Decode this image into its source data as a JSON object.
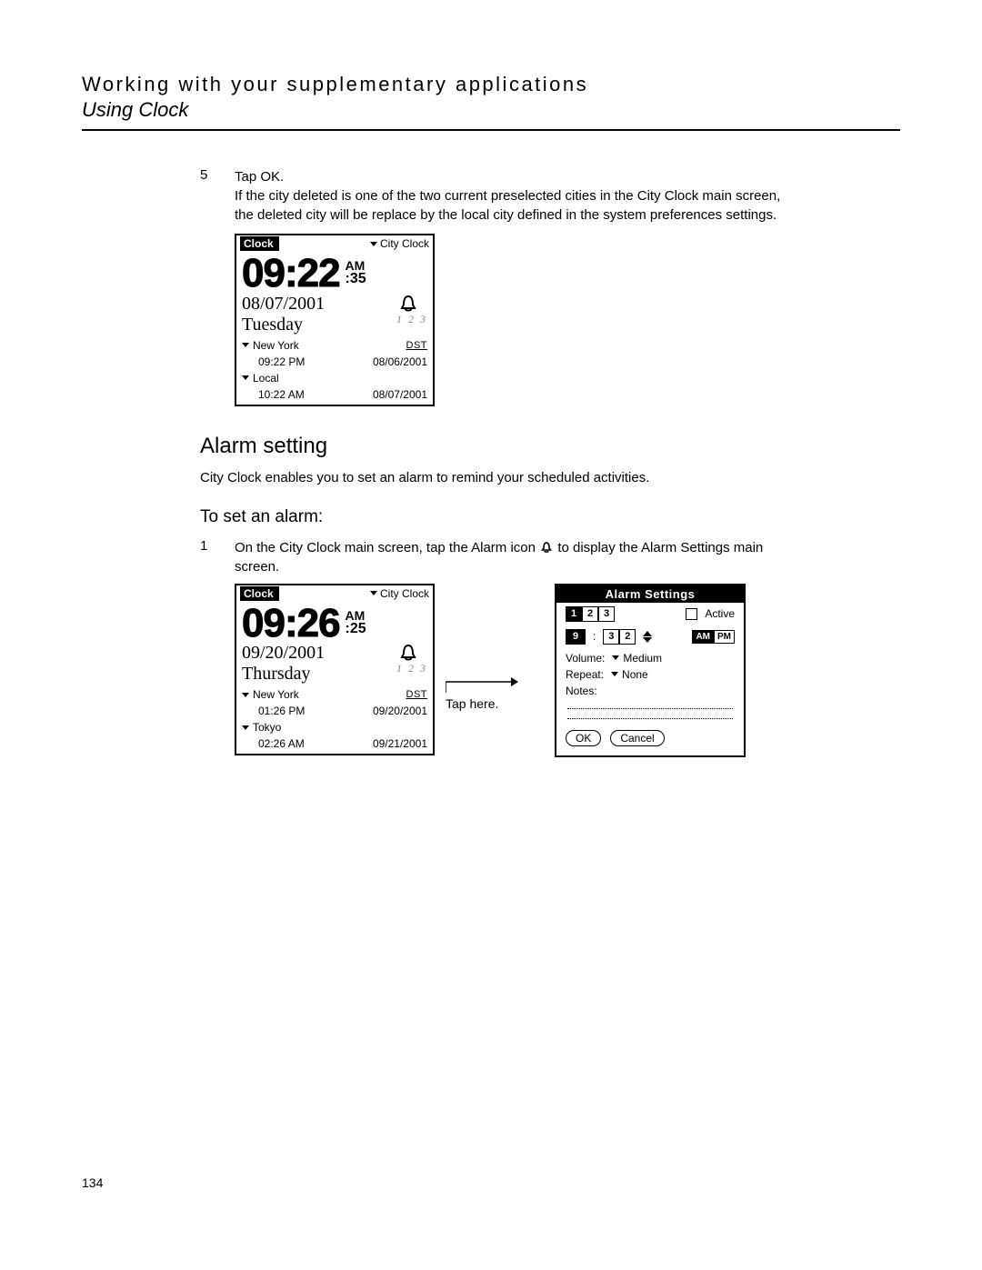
{
  "header": {
    "title": "Working with your supplementary applications",
    "subtitle": "Using Clock"
  },
  "step5": {
    "num": "5",
    "lead": "Tap OK.",
    "body": "If the city deleted is one of the two current preselected cities in the City Clock main screen, the deleted city will be replace by the local city defined in the system preferences settings."
  },
  "screen1": {
    "app_label": "Clock",
    "mode_label": "City Clock",
    "time": "09:22",
    "ampm": "AM",
    "seconds": ":35",
    "date": "08/07/2001",
    "day": "Tuesday",
    "alarm_nums": "1 2 3",
    "city1": {
      "name": "New York",
      "time": "09:22 PM",
      "dst": "DST",
      "date": "08/06/2001"
    },
    "city2": {
      "name": "Local",
      "time": "10:22 AM",
      "dst": "",
      "date": "08/07/2001"
    }
  },
  "alarm_section": {
    "heading": "Alarm setting",
    "intro": "City Clock enables you to set an alarm to remind your scheduled activities.",
    "subheading": "To set an alarm:"
  },
  "step1": {
    "num": "1",
    "text_a": "On the City Clock main screen, tap the Alarm icon ",
    "text_b": " to display the Alarm Settings main screen."
  },
  "screen2": {
    "app_label": "Clock",
    "mode_label": "City Clock",
    "time": "09:26",
    "ampm": "AM",
    "seconds": ":25",
    "date": "09/20/2001",
    "day": "Thursday",
    "alarm_nums": "1 2 3",
    "city1": {
      "name": "New York",
      "time": "01:26 PM",
      "dst": "DST",
      "date": "09/20/2001"
    },
    "city2": {
      "name": "Tokyo",
      "time": "02:26 AM",
      "dst": "",
      "date": "09/21/2001"
    }
  },
  "tap_here": "Tap here.",
  "alarm_dlg": {
    "title": "Alarm Settings",
    "tabs": [
      "1",
      "2",
      "3"
    ],
    "active_label": "Active",
    "hour": "9",
    "min1": "3",
    "min2": "2",
    "am": "AM",
    "pm": "PM",
    "volume_label": "Volume:",
    "volume_val": "Medium",
    "repeat_label": "Repeat:",
    "repeat_val": "None",
    "notes_label": "Notes:",
    "ok": "OK",
    "cancel": "Cancel"
  },
  "page_number": "134"
}
